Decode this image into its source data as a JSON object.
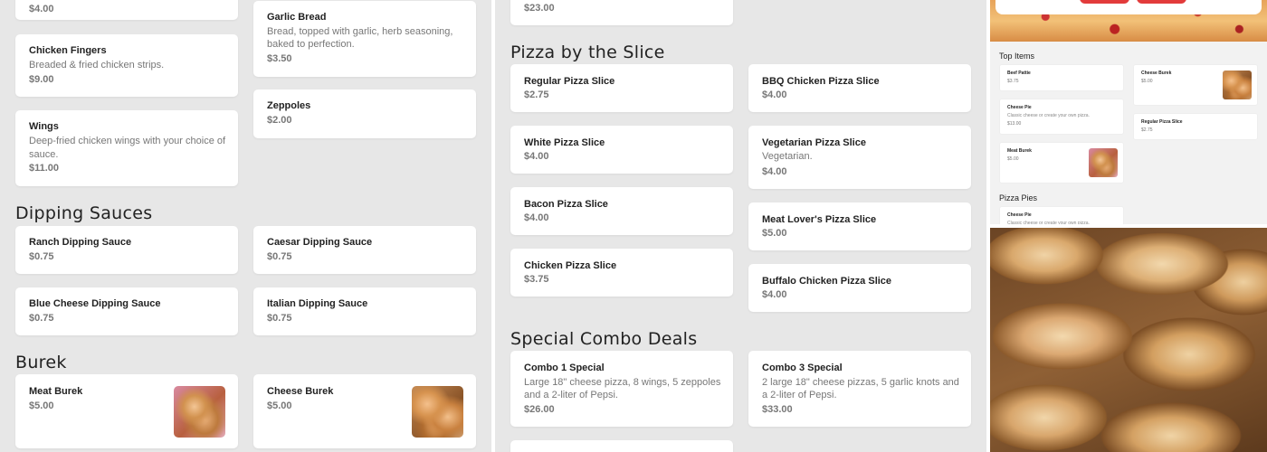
{
  "left": {
    "top_price": "$4.00",
    "cards": [
      {
        "name": "Chicken Fingers",
        "desc": [
          "Breaded & fried chicken strips."
        ],
        "price": "$9.00"
      },
      {
        "name": "Wings",
        "desc": [
          "Deep-fried chicken wings with your choice of",
          "sauce."
        ],
        "price": "$11.00"
      },
      {
        "name": "Garlic Bread",
        "desc": [
          "Bread, topped with garlic, herb seasoning,",
          "baked to perfection."
        ],
        "price": "$3.50"
      },
      {
        "name": "Zeppoles",
        "desc": [],
        "price": "$2.00"
      }
    ],
    "dipping_title": "Dipping Sauces",
    "dipping": [
      {
        "name": "Ranch Dipping Sauce",
        "price": "$0.75"
      },
      {
        "name": "Caesar Dipping Sauce",
        "price": "$0.75"
      },
      {
        "name": "Blue Cheese Dipping Sauce",
        "price": "$0.75"
      },
      {
        "name": "Italian Dipping Sauce",
        "price": "$0.75"
      }
    ],
    "burek_title": "Burek",
    "burek": [
      {
        "name": "Meat Burek",
        "price": "$5.00"
      },
      {
        "name": "Cheese Burek",
        "price": "$5.00"
      }
    ]
  },
  "mid": {
    "top_price": "$23.00",
    "slice_title": "Pizza by the Slice",
    "slices": [
      {
        "name": "Regular Pizza Slice",
        "desc": "",
        "price": "$2.75"
      },
      {
        "name": "BBQ Chicken Pizza Slice",
        "desc": "",
        "price": "$4.00"
      },
      {
        "name": "White Pizza Slice",
        "desc": "",
        "price": "$4.00"
      },
      {
        "name": "Vegetarian Pizza Slice",
        "desc": "Vegetarian.",
        "price": "$4.00"
      },
      {
        "name": "Bacon Pizza Slice",
        "desc": "",
        "price": "$4.00"
      },
      {
        "name": "Meat Lover's Pizza Slice",
        "desc": "",
        "price": "$5.00"
      },
      {
        "name": "Chicken Pizza Slice",
        "desc": "",
        "price": "$3.75"
      },
      {
        "name": "Buffalo Chicken Pizza Slice",
        "desc": "",
        "price": "$4.00"
      }
    ],
    "combo_title": "Special Combo Deals",
    "combos": [
      {
        "name": "Combo 1 Special",
        "desc": [
          "Large 18\" cheese pizza, 8 wings, 5 zeppoles",
          "and a 2-liter of Pepsi."
        ],
        "price": "$26.00"
      },
      {
        "name": "Combo 3 Special",
        "desc": [
          "2 large 18\" cheese pizzas, 5 garlic knots and",
          "a 2-liter of Pepsi."
        ],
        "price": "$33.00"
      }
    ]
  },
  "right": {
    "top_items_title": "Top Items",
    "top_items": [
      {
        "name": "Beef Pattie",
        "desc": "",
        "price": "$3.75"
      },
      {
        "name": "Cheese Burek",
        "desc": "",
        "price": "$5.00"
      },
      {
        "name": "Cheese Pie",
        "desc": "Classic cheese or create your own pizza.",
        "price": "$13.00"
      },
      {
        "name": "Regular Pizza Slice",
        "desc": "",
        "price": "$2.75"
      },
      {
        "name": "Meat Burek",
        "desc": "",
        "price": "$5.00"
      }
    ],
    "pizza_pies_title": "Pizza Pies",
    "pies": [
      {
        "name": "Cheese Pie",
        "desc": "Classic cheese or create your own pizza."
      }
    ]
  },
  "colors": {
    "accent": "#e23b3b",
    "background": "#e7e7e7",
    "card": "#ffffff"
  }
}
